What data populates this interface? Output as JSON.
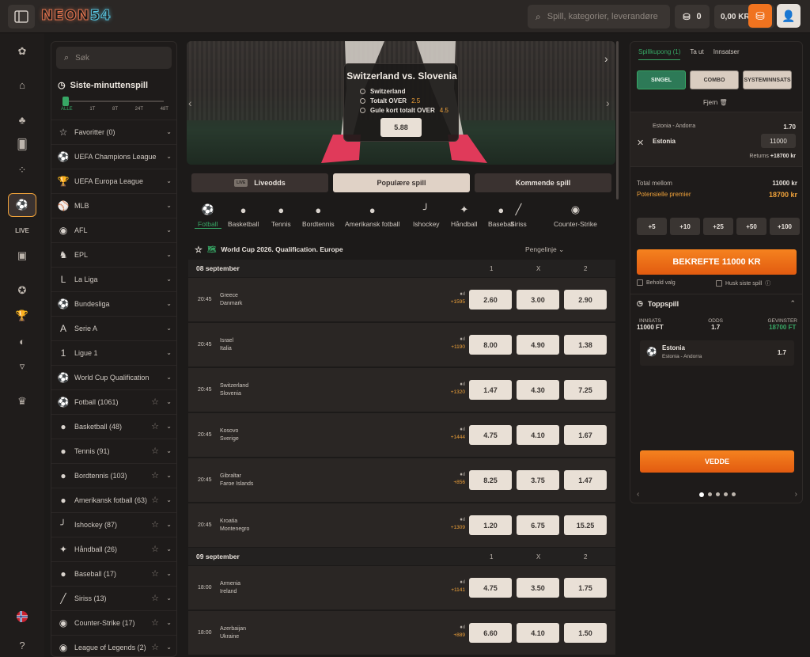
{
  "header": {
    "logo_a": "NEON",
    "logo_b": "54",
    "search_placeholder": "Spill, kategorier, leverandører",
    "coins": "0",
    "balance": "0,00 KR"
  },
  "leftnav": {
    "search_placeholder": "Søk",
    "last_minute": "Siste-minuttenspill",
    "ticks": [
      "ALLE",
      "1T",
      "8T",
      "24T",
      "48T"
    ],
    "items": [
      {
        "label": "Favoritter (0)",
        "icon": "star-icon",
        "glyph": "☆",
        "fav": false
      },
      {
        "label": "UEFA Champions League",
        "icon": "champions-league-icon",
        "glyph": "⚽",
        "fav": false
      },
      {
        "label": "UEFA Europa League",
        "icon": "europa-league-icon",
        "glyph": "🏆",
        "fav": false
      },
      {
        "label": "MLB",
        "icon": "mlb-icon",
        "glyph": "⚾",
        "fav": false
      },
      {
        "label": "AFL",
        "icon": "afl-icon",
        "glyph": "◉",
        "fav": false
      },
      {
        "label": "EPL",
        "icon": "epl-icon",
        "glyph": "♞",
        "fav": false
      },
      {
        "label": "La Liga",
        "icon": "la-liga-icon",
        "glyph": "L",
        "fav": false
      },
      {
        "label": "Bundesliga",
        "icon": "bundesliga-icon",
        "glyph": "⚽",
        "fav": false
      },
      {
        "label": "Serie A",
        "icon": "serie-a-icon",
        "glyph": "A",
        "fav": false
      },
      {
        "label": "Ligue 1",
        "icon": "ligue-1-icon",
        "glyph": "1",
        "fav": false
      },
      {
        "label": "World Cup Qualification",
        "icon": "world-cup-icon",
        "glyph": "⚽",
        "fav": false
      },
      {
        "label": "Fotball (1061)",
        "icon": "football-icon",
        "glyph": "⚽",
        "fav": true
      },
      {
        "label": "Basketball (48)",
        "icon": "basketball-icon",
        "glyph": "●",
        "fav": true
      },
      {
        "label": "Tennis (91)",
        "icon": "tennis-icon",
        "glyph": "●",
        "fav": true
      },
      {
        "label": "Bordtennis (103)",
        "icon": "table-tennis-icon",
        "glyph": "●",
        "fav": true
      },
      {
        "label": "Amerikansk fotball (63)",
        "icon": "american-football-icon",
        "glyph": "●",
        "fav": true
      },
      {
        "label": "Ishockey (87)",
        "icon": "ice-hockey-icon",
        "glyph": "╯",
        "fav": true
      },
      {
        "label": "Håndball (26)",
        "icon": "handball-icon",
        "glyph": "✦",
        "fav": true
      },
      {
        "label": "Baseball (17)",
        "icon": "baseball-icon",
        "glyph": "●",
        "fav": true
      },
      {
        "label": "Siriss (13)",
        "icon": "cricket-icon",
        "glyph": "╱",
        "fav": true
      },
      {
        "label": "Counter-Strike (17)",
        "icon": "counter-strike-icon",
        "glyph": "◉",
        "fav": true
      },
      {
        "label": "League of Legends (2)",
        "icon": "league-of-legends-icon",
        "glyph": "◉",
        "fav": true
      }
    ]
  },
  "hero": {
    "title": "Switzerland  vs.  Slovenia",
    "rows": [
      {
        "label": "Switzerland",
        "value": ""
      },
      {
        "label": "Totalt OVER",
        "value": "2.5"
      },
      {
        "label": "Gule kort totalt OVER",
        "value": "4.5"
      }
    ],
    "odds": "5.88"
  },
  "tabs": [
    {
      "label": "Liveodds",
      "badge": "LIVE",
      "active": false
    },
    {
      "label": "Populære spill",
      "badge": "",
      "active": true
    },
    {
      "label": "Kommende spill",
      "badge": "",
      "active": false
    }
  ],
  "sports": [
    {
      "label": "Fotball",
      "icon": "football-icon",
      "glyph": "⚽",
      "active": true
    },
    {
      "label": "Basketball",
      "icon": "basketball-icon",
      "glyph": "●",
      "active": false
    },
    {
      "label": "Tennis",
      "icon": "tennis-icon",
      "glyph": "●",
      "active": false
    },
    {
      "label": "Bordtennis",
      "icon": "table-tennis-icon",
      "glyph": "●",
      "active": false
    },
    {
      "label": "Amerikansk fotball",
      "icon": "american-football-icon",
      "glyph": "●",
      "active": false
    },
    {
      "label": "Ishockey",
      "icon": "ice-hockey-icon",
      "glyph": "╯",
      "active": false
    },
    {
      "label": "Håndball",
      "icon": "handball-icon",
      "glyph": "✦",
      "active": false
    },
    {
      "label": "Baseball",
      "icon": "baseball-icon",
      "glyph": "●",
      "active": false
    },
    {
      "label": "Siriss",
      "icon": "cricket-icon",
      "glyph": "╱",
      "active": false
    },
    {
      "label": "Counter-Strike",
      "icon": "counter-strike-icon",
      "glyph": "◉",
      "active": false
    }
  ],
  "competition": {
    "title": "World Cup 2026. Qualification. Europe",
    "market": "Pengelinje",
    "col1": "1",
    "colx": "X",
    "col2": "2",
    "groups": [
      {
        "date": "08 september",
        "matches": [
          {
            "time": "20:45",
            "home": "Greece",
            "away": "Danmark",
            "vol": "+1595",
            "o1": "2.60",
            "ox": "3.00",
            "o2": "2.90"
          },
          {
            "time": "20:45",
            "home": "Israel",
            "away": "Italia",
            "vol": "+1190",
            "o1": "8.00",
            "ox": "4.90",
            "o2": "1.38"
          },
          {
            "time": "20:45",
            "home": "Switzerland",
            "away": "Slovenia",
            "vol": "+1320",
            "o1": "1.47",
            "ox": "4.30",
            "o2": "7.25"
          },
          {
            "time": "20:45",
            "home": "Kosovo",
            "away": "Sverige",
            "vol": "+1444",
            "o1": "4.75",
            "ox": "4.10",
            "o2": "1.67"
          },
          {
            "time": "20:45",
            "home": "Gibraltar",
            "away": "Faroe Islands",
            "vol": "+856",
            "o1": "8.25",
            "ox": "3.75",
            "o2": "1.47"
          },
          {
            "time": "20:45",
            "home": "Kroatia",
            "away": "Montenegro",
            "vol": "+1309",
            "o1": "1.20",
            "ox": "6.75",
            "o2": "15.25"
          }
        ]
      },
      {
        "date": "09 september",
        "matches": [
          {
            "time": "18:00",
            "home": "Armenia",
            "away": "Ireland",
            "vol": "+1141",
            "o1": "4.75",
            "ox": "3.50",
            "o2": "1.75"
          },
          {
            "time": "18:00",
            "home": "Azerbaijan",
            "away": "Ukraine",
            "vol": "+889",
            "o1": "6.60",
            "ox": "4.10",
            "o2": "1.50"
          }
        ]
      }
    ]
  },
  "betslip": {
    "tabs": [
      "Spillkupong (1)",
      "Ta ut",
      "Innsatser"
    ],
    "modes": [
      "SINGEL",
      "COMBO",
      "SYSTEMINNSATS"
    ],
    "remove": "Fjern",
    "selection": {
      "match": "Estonia - Andorra",
      "odds": "1.70",
      "team": "Estonia",
      "stake": "11000",
      "returns_label": "Returns",
      "returns_value": "+18700 kr"
    },
    "total_label": "Total mellom",
    "total_value": "11000 kr",
    "potential_label": "Potensielle premier",
    "potential_value": "18700 kr",
    "quick": [
      "+5",
      "+10",
      "+25",
      "+50",
      "+100"
    ],
    "confirm": "BEKREFTE 11000 KR",
    "keep_label": "Behold valg",
    "remember_label": "Husk siste spill",
    "top_title": "Toppspill",
    "top_cols": [
      {
        "label": "INNSATS",
        "value": "11000 FT"
      },
      {
        "label": "ODDS",
        "value": "1.7"
      },
      {
        "label": "GEVINSTER",
        "value": "18700 FT"
      }
    ],
    "top_card": {
      "name": "Estonia",
      "sub": "Estonia - Andorra",
      "odds": "1.7"
    },
    "bet_button": "VEDDE"
  },
  "colors": {
    "accent": "#f0731f",
    "green": "#37a765",
    "odds_bg": "#e9e0d6"
  }
}
